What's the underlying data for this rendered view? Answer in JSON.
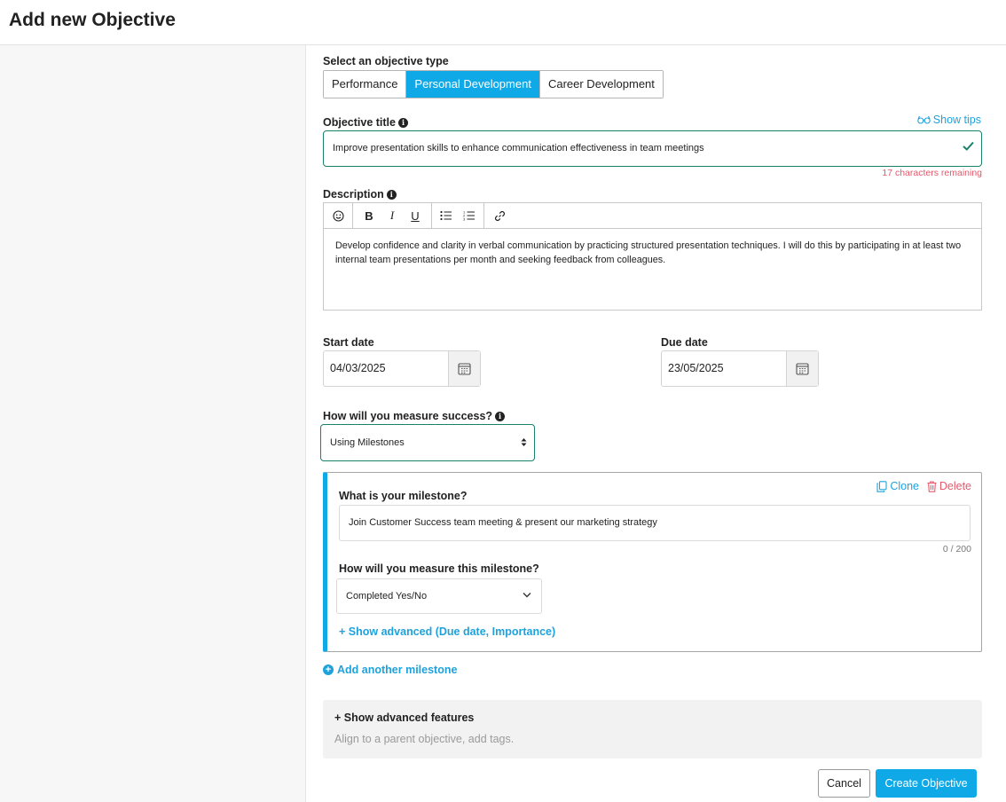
{
  "page": {
    "title": "Add new Objective"
  },
  "objective_type": {
    "label": "Select an objective type",
    "options": [
      "Performance",
      "Personal Development",
      "Career Development"
    ],
    "selected": "Personal Development"
  },
  "objective_title": {
    "label": "Objective title",
    "value": "Improve presentation skills to enhance communication effectiveness in team meetings",
    "remaining": "17 characters remaining",
    "show_tips": "Show tips"
  },
  "description": {
    "label": "Description",
    "value": "Develop confidence and clarity in verbal communication by practicing structured presentation techniques. I will do this by participating in at least two internal team presentations per month and seeking feedback from colleagues."
  },
  "start_date": {
    "label": "Start date",
    "value": "04/03/2025"
  },
  "due_date": {
    "label": "Due date",
    "value": "23/05/2025"
  },
  "measure": {
    "label": "How will you measure success?",
    "value": "Using Milestones"
  },
  "milestone": {
    "clone": "Clone",
    "delete": "Delete",
    "question": "What is your milestone?",
    "value": "Join Customer Success team meeting & present our marketing strategy",
    "counter": "0 / 200",
    "measure_label": "How will you measure this milestone?",
    "measure_value": "Completed Yes/No",
    "advanced_link": "+ Show advanced (Due date, Importance)"
  },
  "add_milestone": "Add another milestone",
  "advanced": {
    "title": "+ Show advanced features",
    "subtitle": "Align to a parent objective, add tags."
  },
  "actions": {
    "cancel": "Cancel",
    "create": "Create Objective"
  },
  "colors": {
    "accent": "#10a9e8",
    "link": "#1fa2dc",
    "valid": "#19806a",
    "danger": "#e5596b"
  }
}
